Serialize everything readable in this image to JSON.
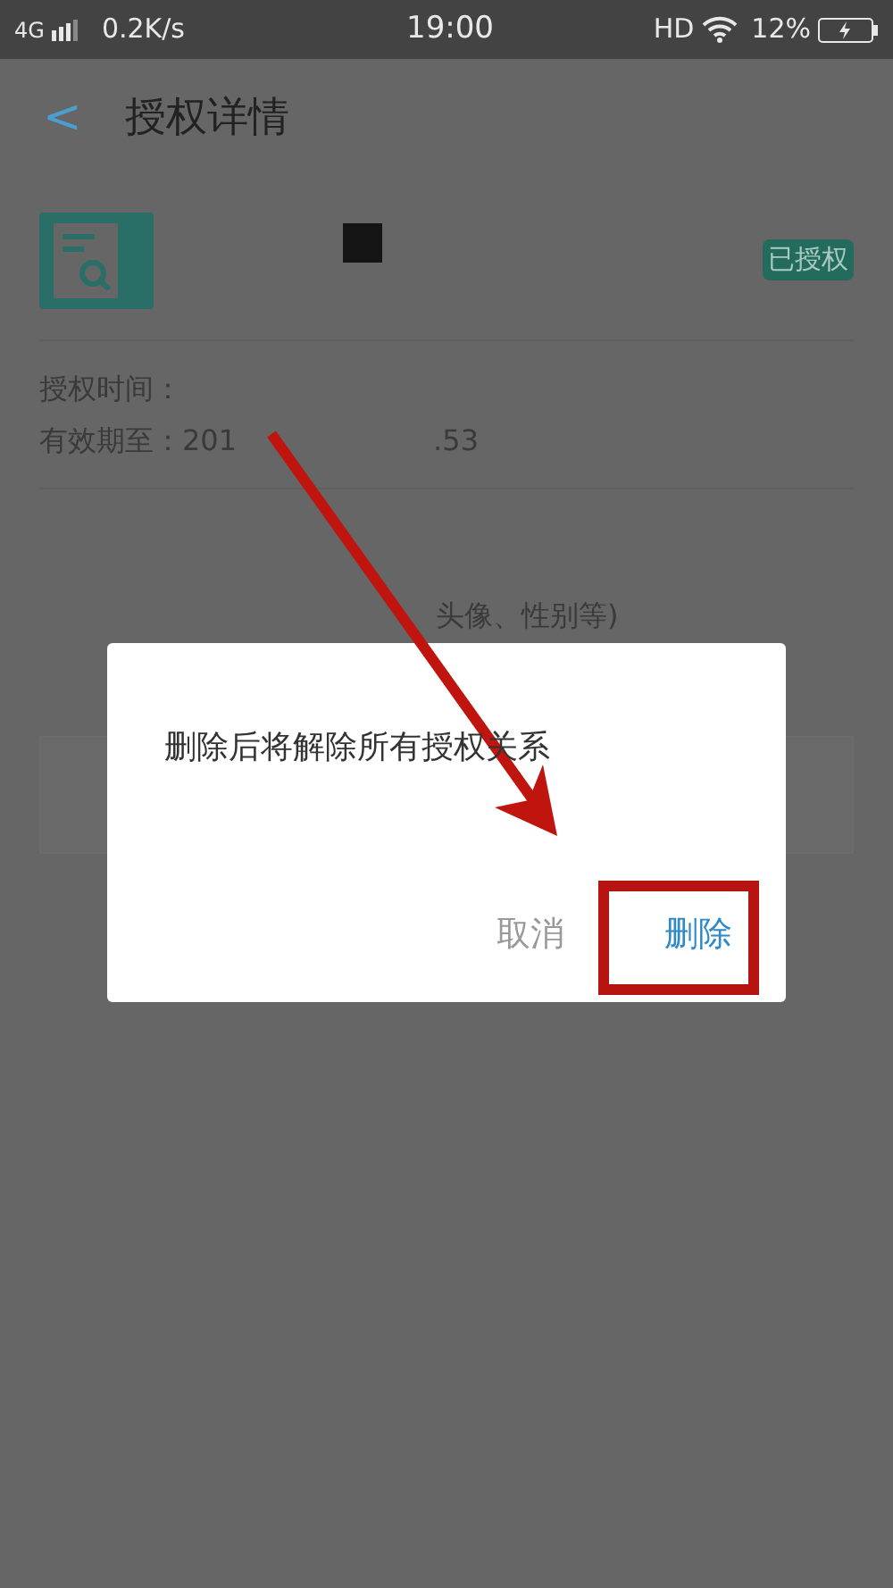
{
  "status_bar": {
    "network": "4G",
    "speed": "0.2K/s",
    "time": "19:00",
    "hd": "HD",
    "battery": "12%"
  },
  "header": {
    "back": "<",
    "title": "授权详情"
  },
  "app": {
    "badge": "已授权"
  },
  "details": [
    {
      "label": "授权时间："
    },
    {
      "label": "有效期至：",
      "value": "201",
      "value_2": ".53"
    }
  ],
  "scope": {
    "visible_text": "头像、性别等)"
  },
  "dialog": {
    "message": "删除后将解除所有授权关系",
    "buttons": [
      {
        "label": "取消",
        "kind": "cancel"
      },
      {
        "label": "删除",
        "kind": "confirm"
      }
    ]
  }
}
